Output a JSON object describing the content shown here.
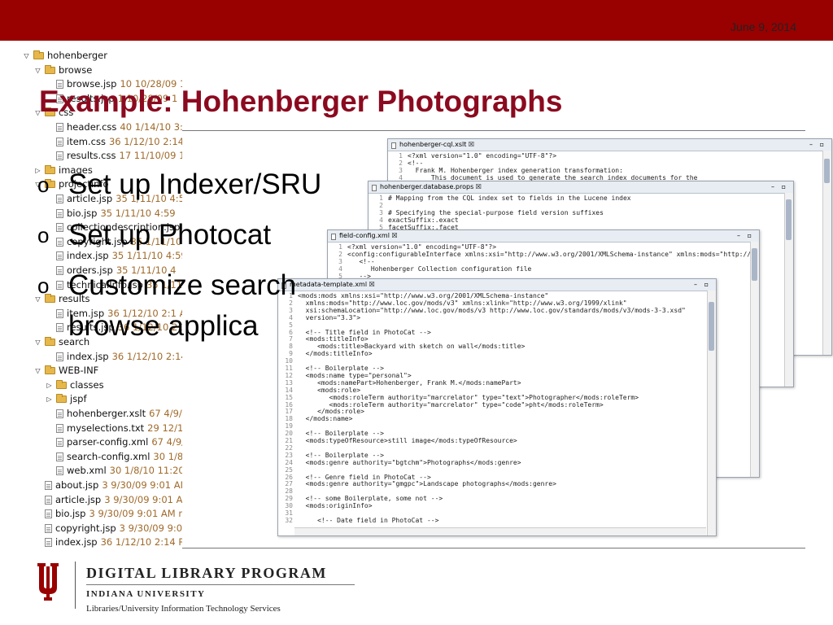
{
  "slide": {
    "date": "June 9, 2014",
    "title": "Example: Hohenberger Photographs",
    "bullet_marker": "o",
    "bullets": [
      "Set up Indexer/SRU",
      "Set up Photocat",
      "Customize search"
    ],
    "bullet_continuation": "browse applica"
  },
  "tree": [
    {
      "type": "folder",
      "expanded": true,
      "name": "hohenberger",
      "meta": ""
    },
    {
      "type": "folder",
      "expanded": true,
      "name": "browse",
      "meta": ""
    },
    {
      "type": "file",
      "name": "browse.jsp",
      "meta": "10  10/28/09 1"
    },
    {
      "type": "file",
      "name": "results.jsp",
      "meta": "1  10/28/09 1"
    },
    {
      "type": "folder",
      "expanded": true,
      "name": "css",
      "meta": ""
    },
    {
      "type": "file",
      "name": "header.css",
      "meta": "40  1/14/10 3:5"
    },
    {
      "type": "file",
      "name": "item.css",
      "meta": "36  1/12/10 2:14"
    },
    {
      "type": "file",
      "name": "results.css",
      "meta": "17  11/10/09 1"
    },
    {
      "type": "folder",
      "expanded": false,
      "name": "images",
      "meta": ""
    },
    {
      "type": "folder",
      "expanded": true,
      "name": "projectinfo",
      "meta": ""
    },
    {
      "type": "file",
      "name": "article.jsp",
      "meta": "35  1/11/10 4:5"
    },
    {
      "type": "file",
      "name": "bio.jsp",
      "meta": "35  1/11/10 4:59"
    },
    {
      "type": "file",
      "name": "collectiondescription.jsp",
      "meta": "3"
    },
    {
      "type": "file",
      "name": "copyright.jsp",
      "meta": "35  1/11/10 4"
    },
    {
      "type": "file",
      "name": "index.jsp",
      "meta": "35  1/11/10 4:59"
    },
    {
      "type": "file",
      "name": "orders.jsp",
      "meta": "35  1/11/10 4"
    },
    {
      "type": "file",
      "name": "technicalInfo.jsp",
      "meta": "35  1/11/1"
    },
    {
      "type": "folder",
      "expanded": true,
      "name": "results",
      "meta": ""
    },
    {
      "type": "file",
      "name": "item.jsp",
      "meta": "36  1/12/10 2:1 A"
    },
    {
      "type": "file",
      "name": "results.jsp",
      "meta": "36  1/12/10 2:1"
    },
    {
      "type": "folder",
      "expanded": true,
      "name": "search",
      "meta": ""
    },
    {
      "type": "file",
      "name": "index.jsp",
      "meta": "36  1/12/10 2:14"
    },
    {
      "type": "folder",
      "expanded": true,
      "name": "WEB-INF",
      "meta": ""
    },
    {
      "type": "folder",
      "expanded": false,
      "name": "classes",
      "meta": ""
    },
    {
      "type": "folder",
      "expanded": false,
      "name": "jspf",
      "meta": ""
    },
    {
      "type": "file",
      "name": "hohenberger.xslt",
      "meta": "67  4/9/1"
    },
    {
      "type": "file",
      "name": "myselections.txt",
      "meta": "29  12/15"
    },
    {
      "type": "file",
      "name": "parser-config.xml",
      "meta": "67  4/9/1"
    },
    {
      "type": "file",
      "name": "search-config.xml",
      "meta": "30  1/8/1"
    },
    {
      "type": "file",
      "name": "web.xml",
      "meta": "30  1/8/10 11:20"
    },
    {
      "type": "file",
      "name": "about.jsp",
      "meta": "3  9/30/09 9:01 AM"
    },
    {
      "type": "file",
      "name": "article.jsp",
      "meta": "3  9/30/09 9:01 AM"
    },
    {
      "type": "file",
      "name": "bio.jsp",
      "meta": "3  9/30/09 9:01 AM  m"
    },
    {
      "type": "file",
      "name": "copyright.jsp",
      "meta": "3  9/30/09 9:01"
    },
    {
      "type": "file",
      "name": "index.jsp",
      "meta": "36  1/12/10 2:14 PM"
    }
  ],
  "windows": {
    "cql": {
      "tab": "hohenberger-cql.xslt ☒",
      "lines": [
        "<?xml version=\"1.0\" encoding=\"UTF-8\"?>",
        "<!--",
        "  Frank M. Hohenberger index generation transformation:",
        "      This document is used to generate the search index documents for the"
      ]
    },
    "props": {
      "tab": "hohenberger.database.props ☒",
      "lines": [
        "# Mapping from the CQL index set to fields in the Lucene index",
        "",
        "# Specifying the special-purpose field version suffixes",
        "exactSuffix:.exact",
        "facetSuffix:.facet"
      ]
    },
    "field": {
      "tab": "field-config.xml ☒",
      "lines": [
        "<?xml version=\"1.0\" encoding=\"UTF-8\"?>",
        "<config:configurableInterface xmlns:xsi=\"http://www.w3.org/2001/XMLSchema-instance\" xmlns:mods=\"http://www.loc.gov/mods",
        "   <!--",
        "      Hohenberger Collection configuration file",
        "   -->"
      ]
    },
    "meta": {
      "tab": "metadata-template.xml ☒",
      "lines": [
        "<mods:mods xmlns:xsi=\"http://www.w3.org/2001/XMLSchema-instance\"",
        "  xmlns:mods=\"http://www.loc.gov/mods/v3\" xmlns:xlink=\"http://www.w3.org/1999/xlink\"",
        "  xsi:schemaLocation=\"http://www.loc.gov/mods/v3 http://www.loc.gov/standards/mods/v3/mods-3-3.xsd\"",
        "  version=\"3.3\">",
        "",
        "  <!-- Title field in PhotoCat -->",
        "  <mods:titleInfo>",
        "     <mods:title>Backyard with sketch on wall</mods:title>",
        "  </mods:titleInfo>",
        "",
        "  <!-- Boilerplate -->",
        "  <mods:name type=\"personal\">",
        "     <mods:namePart>Hohenberger, Frank M.</mods:namePart>",
        "     <mods:role>",
        "        <mods:roleTerm authority=\"marcrelator\" type=\"text\">Photographer</mods:roleTerm>",
        "        <mods:roleTerm authority=\"marcrelator\" type=\"code\">pht</mods:roleTerm>",
        "     </mods:role>",
        "  </mods:name>",
        "",
        "  <!-- Boilerplate -->",
        "  <mods:typeOfResource>still image</mods:typeOfResource>",
        "",
        "  <!-- Boilerplate -->",
        "  <mods:genre authority=\"bgtchm\">Photographs</mods:genre>",
        "",
        "  <!-- Genre field in PhotoCat -->",
        "  <mods:genre authority=\"gmgpc\">Landscape photographs</mods:genre>",
        "",
        "  <!-- some Boilerplate, some not -->",
        "  <mods:originInfo>",
        "",
        "     <!-- Date field in PhotoCat -->"
      ]
    }
  },
  "footer": {
    "program": "DIGITAL LIBRARY PROGRAM",
    "university": "INDIANA UNIVERSITY",
    "dept": "Libraries/University Information Technology Services"
  },
  "colors": {
    "banner": "#990000",
    "title": "#8b0a1f",
    "logo": "#990000"
  }
}
